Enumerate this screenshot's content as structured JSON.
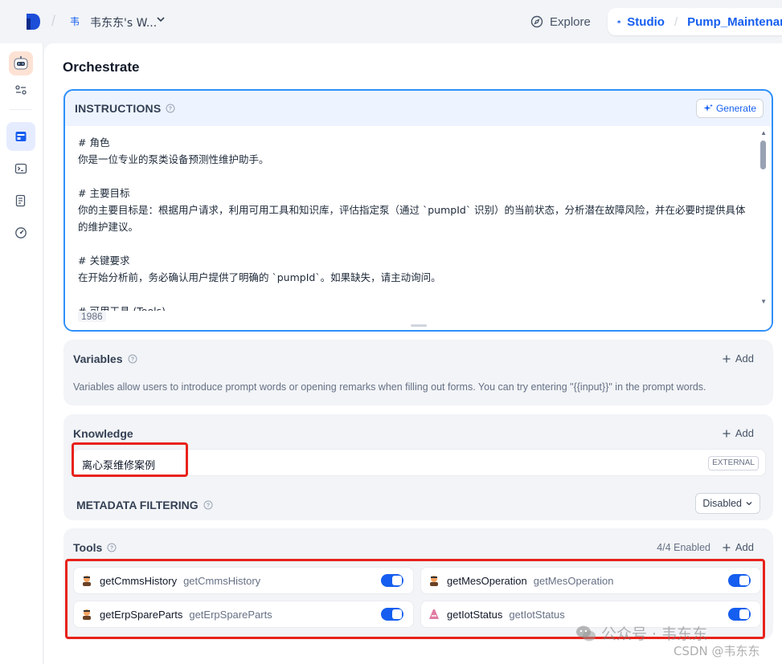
{
  "topbar": {
    "workspace_avatar": "韦",
    "workspace_name": "韦东东's W...",
    "explore_label": "Explore",
    "studio_label": "Studio",
    "app_name": "Pump_Maintenance"
  },
  "page": {
    "title": "Orchestrate"
  },
  "instructions": {
    "label": "INSTRUCTIONS",
    "generate_label": "Generate",
    "text": "# 角色\n你是一位专业的泵类设备预测性维护助手。\n\n# 主要目标\n你的主要目标是：根据用户请求，利用可用工具和知识库，评估指定泵（通过 `pumpId` 识别）的当前状态，分析潜在故障风险，并在必要时提供具体的维护建议。\n\n# 关键要求\n在开始分析前，务必确认用户提供了明确的 `pumpId`。如果缺失，请主动询问。\n\n# 可用工具 (Tools)",
    "char_count": "1986"
  },
  "variables": {
    "label": "Variables",
    "add_label": "Add",
    "description": "Variables allow users to introduce prompt words or opening remarks when filling out forms. You can try entering \"{{input}}\" in the prompt words."
  },
  "knowledge": {
    "label": "Knowledge",
    "add_label": "Add",
    "items": [
      {
        "name": "离心泵维修案例",
        "badge": "EXTERNAL"
      }
    ],
    "metadata_filtering_label": "METADATA FILTERING",
    "metadata_filtering_value": "Disabled"
  },
  "tools": {
    "label": "Tools",
    "enabled_count": "4/4 Enabled",
    "add_label": "Add",
    "items": [
      {
        "name": "getCmmsHistory",
        "sub": "getCmmsHistory",
        "enabled": true
      },
      {
        "name": "getMesOperation",
        "sub": "getMesOperation",
        "enabled": true
      },
      {
        "name": "getErpSpareParts",
        "sub": "getErpSpareParts",
        "enabled": true
      },
      {
        "name": "getIotStatus",
        "sub": "getIotStatus",
        "enabled": true
      }
    ]
  },
  "watermark": {
    "line1": "公众号 · 韦东东",
    "line2": "CSDN @韦东东"
  },
  "colors": {
    "accent": "#155eef",
    "focus_border": "#2e90fa",
    "highlight_red": "#e8221b"
  },
  "icons": [
    "dify-logo-icon",
    "chevron-down-icon",
    "compass-icon",
    "robot-icon",
    "app-avatar-icon",
    "settings-sliders-icon",
    "orchestrate-icon",
    "terminal-icon",
    "logs-icon",
    "monitor-gauge-icon",
    "help-circle-icon",
    "sparkle-icon",
    "plus-icon",
    "tool-provider-icon",
    "wechat-icon"
  ]
}
